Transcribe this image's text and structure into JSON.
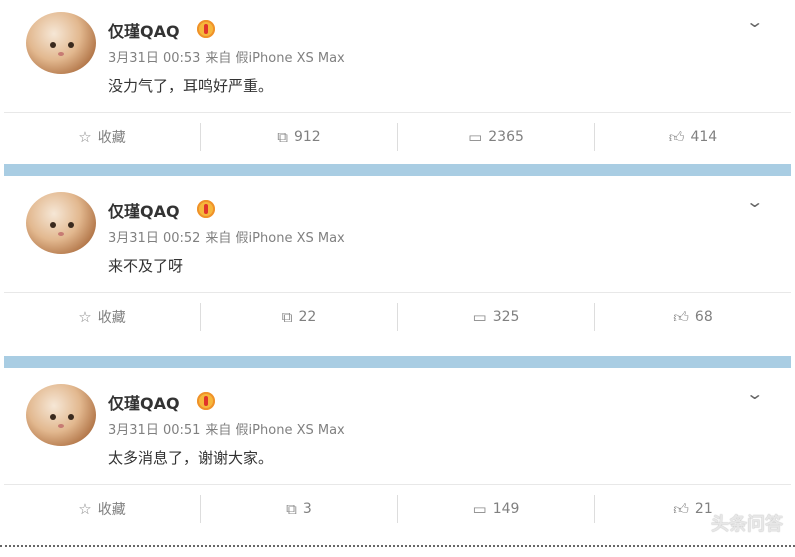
{
  "posts": [
    {
      "username": "仅瑾QAQ",
      "time": "3月31日 00:53",
      "source": "来自 假iPhone XS Max",
      "text": "没力气了，耳鸣好严重。",
      "actions": {
        "favorite": "收藏",
        "repost": "912",
        "comment": "2365",
        "like": "414"
      }
    },
    {
      "username": "仅瑾QAQ",
      "time": "3月31日 00:52",
      "source": "来自 假iPhone XS Max",
      "text": "来不及了呀",
      "actions": {
        "favorite": "收藏",
        "repost": "22",
        "comment": "325",
        "like": "68"
      }
    },
    {
      "username": "仅瑾QAQ",
      "time": "3月31日 00:51",
      "source": "来自 假iPhone XS Max",
      "text": "太多消息了，谢谢大家。",
      "actions": {
        "favorite": "收藏",
        "repost": "3",
        "comment": "149",
        "like": "21"
      }
    }
  ],
  "icons": {
    "favorite": "star-icon",
    "repost": "share-icon",
    "comment": "comment-icon",
    "like": "thumbs-up-icon",
    "menu": "chevron-down-icon",
    "badge": "verified-badge-icon"
  },
  "colors": {
    "separator": "#a9cde3",
    "meta_text": "#808080"
  },
  "watermark": "头条问答"
}
